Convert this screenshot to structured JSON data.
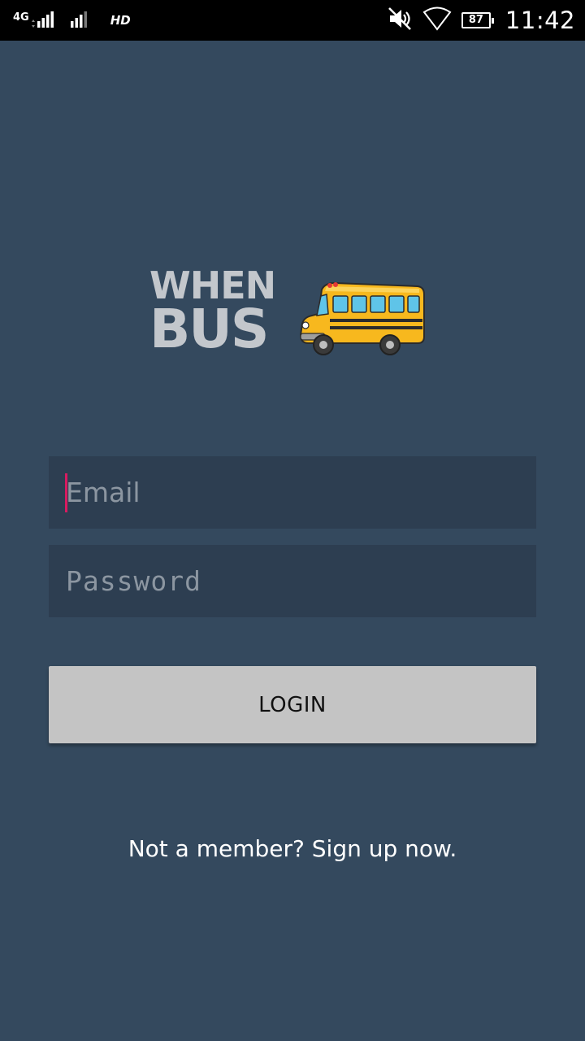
{
  "status_bar": {
    "network_type": "4G",
    "sim1_label": "1",
    "sim2_label": "2",
    "hd_label": "HD",
    "battery_level": "87",
    "clock": "11:42",
    "icons": [
      "signal-sim1-icon",
      "signal-sim2-icon",
      "vibrate-muted-icon",
      "wifi-icon",
      "battery-icon"
    ]
  },
  "logo": {
    "line1": "WHEN",
    "line2": "BUS",
    "icon": "school-bus-icon",
    "colors": {
      "text": "#c3c7cc",
      "bus": "#f7b81e"
    }
  },
  "form": {
    "email": {
      "placeholder": "Email",
      "value": ""
    },
    "password": {
      "placeholder": "Password",
      "value": ""
    },
    "login_label": "LOGIN",
    "signup_text": "Not a member? Sign up now."
  },
  "colors": {
    "background": "#34495e",
    "field_background": "#2d3e51",
    "button_background": "#c4c4c4",
    "caret_accent": "#d81b60"
  }
}
